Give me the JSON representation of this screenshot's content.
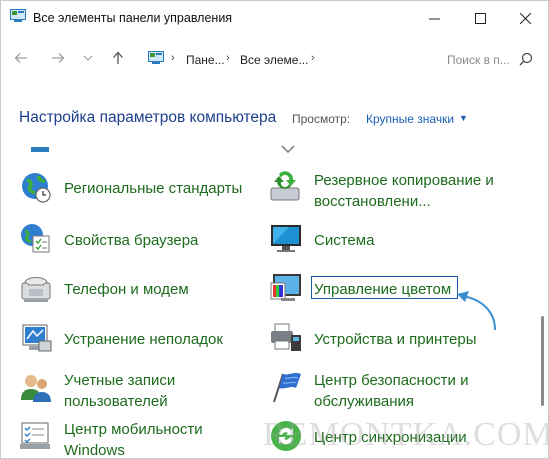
{
  "window": {
    "title": "Все элементы панели управления"
  },
  "address": {
    "crumbs": [
      "Пане...",
      "Все элеме..."
    ]
  },
  "search": {
    "placeholder": "Поиск в п..."
  },
  "header": {
    "title": "Настройка параметров компьютера",
    "view_label": "Просмотр:",
    "view_value": "Крупные значки"
  },
  "items": [
    {
      "label": "Региональные стандарты",
      "icon": "globe-clock-icon"
    },
    {
      "label": "Резервное копирование и\nвосстановлени...",
      "icon": "backup-restore-icon"
    },
    {
      "label": "Свойства браузера",
      "icon": "internet-options-icon"
    },
    {
      "label": "Система",
      "icon": "system-monitor-icon"
    },
    {
      "label": "Телефон и модем",
      "icon": "phone-modem-icon"
    },
    {
      "label": "Управление цветом",
      "icon": "color-management-icon"
    },
    {
      "label": "Устранение неполадок",
      "icon": "troubleshooting-icon"
    },
    {
      "label": "Устройства и принтеры",
      "icon": "devices-printers-icon"
    },
    {
      "label": "Учетные записи\nпользователей",
      "icon": "user-accounts-icon"
    },
    {
      "label": "Центр безопасности и\nобслуживания",
      "icon": "security-flag-icon"
    },
    {
      "label": "Центр мобильности\nWindows",
      "icon": "mobility-center-icon"
    },
    {
      "label": "Центр синхронизации",
      "icon": "sync-center-icon"
    }
  ],
  "watermark": "REMONTKA.COM",
  "colors": {
    "link_green": "#1d6b1d",
    "heading_blue": "#1e3f8c",
    "accent_blue": "#1a5fb4"
  }
}
